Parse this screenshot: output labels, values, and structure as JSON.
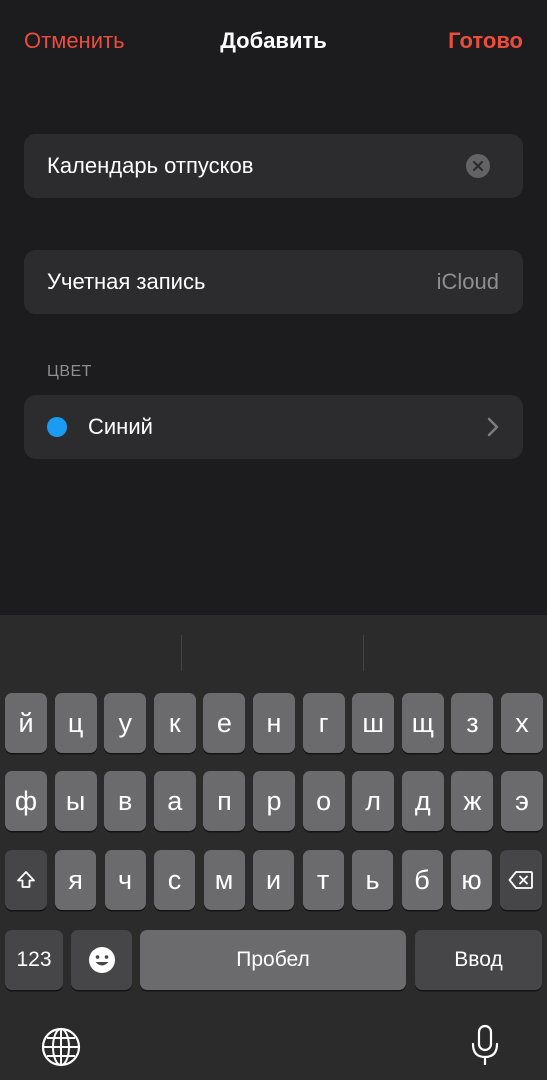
{
  "nav": {
    "cancel_label": "Отменить",
    "title": "Добавить",
    "done_label": "Готово"
  },
  "name_field": {
    "value": "Календарь отпусков",
    "clear_icon": "clear-circle-icon"
  },
  "account": {
    "label": "Учетная запись",
    "value": "iCloud"
  },
  "color_section": {
    "header": "ЦВЕТ",
    "color_name": "Синий",
    "color_hex": "#1a9cf2"
  },
  "keyboard": {
    "row1": [
      "й",
      "ц",
      "у",
      "к",
      "е",
      "н",
      "г",
      "ш",
      "щ",
      "з",
      "х"
    ],
    "row2": [
      "ф",
      "ы",
      "в",
      "а",
      "п",
      "р",
      "о",
      "л",
      "д",
      "ж",
      "э"
    ],
    "row3": [
      "я",
      "ч",
      "с",
      "м",
      "и",
      "т",
      "ь",
      "б",
      "ю"
    ],
    "numbers_label": "123",
    "space_label": "Пробел",
    "return_label": "Ввод",
    "icons": {
      "shift": "shift-icon",
      "delete": "delete-icon",
      "emoji": "emoji-icon",
      "globe": "globe-icon",
      "mic": "mic-icon"
    }
  },
  "colors": {
    "accent": "#eb4d3d",
    "background": "#1c1c1e",
    "cell": "#2c2c2e",
    "secondary_text": "#8e8e93"
  }
}
